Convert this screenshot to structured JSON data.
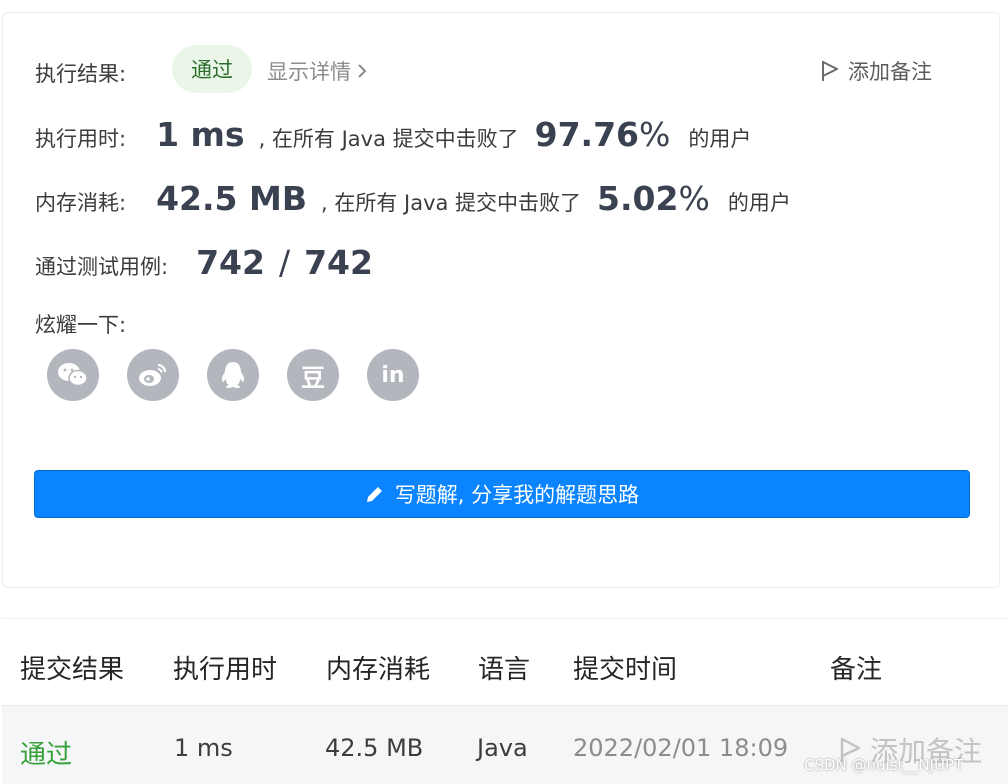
{
  "result": {
    "label": "执行结果:",
    "status": "通过",
    "detail_link": "显示详情",
    "add_note": "添加备注"
  },
  "runtime": {
    "label": "执行用时:",
    "value": "1 ms",
    "prefix": ", 在所有 Java 提交中击败了",
    "percent": "97.76",
    "percent_sign": "%",
    "suffix": "的用户"
  },
  "memory": {
    "label": "内存消耗:",
    "value": "42.5 MB",
    "prefix": ", 在所有 Java 提交中击败了",
    "percent": "5.02",
    "percent_sign": "%",
    "suffix": "的用户"
  },
  "tests": {
    "label": "通过测试用例:",
    "passed": "742",
    "separator": "/",
    "total": "742"
  },
  "share": {
    "label": "炫耀一下:",
    "icons": [
      "wechat-icon",
      "weibo-icon",
      "qq-icon",
      "douban-icon",
      "linkedin-icon"
    ],
    "douban_glyph": "豆",
    "linkedin_glyph": "in"
  },
  "write_button": "写题解, 分享我的解题思路",
  "table": {
    "headers": [
      "提交结果",
      "执行用时",
      "内存消耗",
      "语言",
      "提交时间",
      "备注"
    ],
    "rows": [
      {
        "status": "通过",
        "runtime": "1 ms",
        "memory": "42.5 MB",
        "language": "Java",
        "time": "2022/02/01 18:09",
        "note": "添加备注"
      }
    ]
  },
  "watermark": "CSDN @nuist__NJUPT",
  "colors": {
    "accent": "#0a84ff",
    "pass": "#37a13a",
    "icon_gray": "#b3b6bd"
  }
}
